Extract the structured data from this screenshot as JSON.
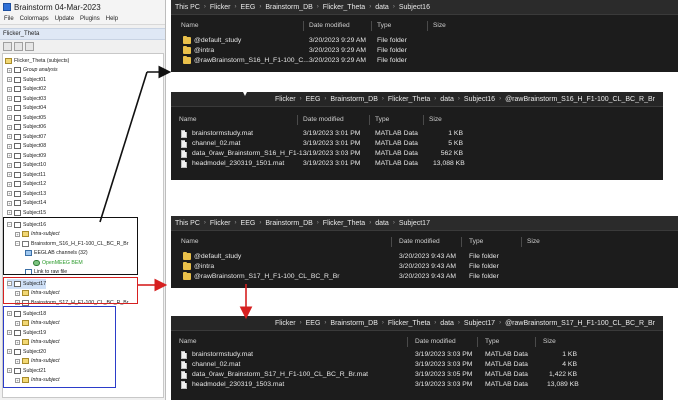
{
  "brainstorm": {
    "title": "Brainstorm 04-Mar-2023",
    "menu": [
      "File",
      "Colormaps",
      "Update",
      "Plugins",
      "Help"
    ],
    "protocol": "Flicker_Theta",
    "tree": {
      "root": "Flicker_Theta (subjects)",
      "group": "Group analysis",
      "subjects_a": [
        "Subject01",
        "Subject02",
        "Subject03",
        "Subject04",
        "Subject05",
        "Subject06",
        "Subject07",
        "Subject08",
        "Subject09",
        "Subject10",
        "Subject11",
        "Subject12",
        "Subject13",
        "Subject14",
        "Subject15"
      ],
      "subject16": "Subject16",
      "intra": "Intra-subject",
      "condition16": "Brainstorm_S16_H_F1-100_CL_BC_R_Br",
      "channels": "EEGLAB channels (32)",
      "bem": "OpenMEEG BEM",
      "link": "Link to raw file",
      "subject17": "Subject17",
      "condition17": "Brainstorm_S17_H_F1-100_CL_BC_R_Br",
      "subjects_b": [
        "Subject18",
        "Subject19",
        "Subject20",
        "Subject21"
      ]
    }
  },
  "explorer1": {
    "path": [
      "This PC",
      "Flicker",
      "EEG",
      "Brainstorm_DB",
      "Flicker_Theta",
      "data",
      "Subject16"
    ],
    "headers": [
      "Name",
      "Date modified",
      "Type",
      "Size"
    ],
    "rows": [
      {
        "name": "@default_study",
        "date": "3/20/2023 9:29 AM",
        "type": "File folder",
        "size": ""
      },
      {
        "name": "@intra",
        "date": "3/20/2023 9:29 AM",
        "type": "File folder",
        "size": ""
      },
      {
        "name": "@rawBrainstorm_S16_H_F1-100_C...",
        "date": "3/20/2023 9:29 AM",
        "type": "File folder",
        "size": ""
      }
    ]
  },
  "explorer2": {
    "path": [
      "Flicker",
      "EEG",
      "Brainstorm_DB",
      "Flicker_Theta",
      "data",
      "Subject16",
      "@rawBrainstorm_S16_H_F1-100_CL_BC_R_Br"
    ],
    "headers": [
      "Name",
      "Date modified",
      "Type",
      "Size"
    ],
    "rows": [
      {
        "name": "brainstormstudy.mat",
        "date": "3/19/2023 3:01 PM",
        "type": "MATLAB Data",
        "size": "1 KB"
      },
      {
        "name": "channel_02.mat",
        "date": "3/19/2023 3:01 PM",
        "type": "MATLAB Data",
        "size": "5 KB"
      },
      {
        "name": "data_0raw_Brainstorm_S16_H_F1-1...",
        "date": "3/19/2023 3:03 PM",
        "type": "MATLAB Data",
        "size": "562 KB"
      },
      {
        "name": "headmodel_230319_1501.mat",
        "date": "3/19/2023 3:01 PM",
        "type": "MATLAB Data",
        "size": "13,088 KB"
      }
    ]
  },
  "explorer3": {
    "path": [
      "This PC",
      "Flicker",
      "EEG",
      "Brainstorm_DB",
      "Flicker_Theta",
      "data",
      "Subject17"
    ],
    "headers": [
      "Name",
      "Date modified",
      "Type",
      "Size"
    ],
    "rows": [
      {
        "name": "@default_study",
        "date": "3/20/2023 9:43 AM",
        "type": "File folder",
        "size": ""
      },
      {
        "name": "@intra",
        "date": "3/20/2023 9:43 AM",
        "type": "File folder",
        "size": ""
      },
      {
        "name": "@rawBrainstorm_S17_H_F1-100_CL_BC_R_Br",
        "date": "3/20/2023 9:43 AM",
        "type": "File folder",
        "size": ""
      }
    ]
  },
  "explorer4": {
    "path": [
      "Flicker",
      "EEG",
      "Brainstorm_DB",
      "Flicker_Theta",
      "data",
      "Subject17",
      "@rawBrainstorm_S17_H_F1-100_CL_BC_R_Br"
    ],
    "headers": [
      "Name",
      "Date modified",
      "Type",
      "Size"
    ],
    "rows": [
      {
        "name": "brainstormstudy.mat",
        "date": "3/19/2023 3:03 PM",
        "type": "MATLAB Data",
        "size": "1 KB"
      },
      {
        "name": "channel_02.mat",
        "date": "3/19/2023 3:03 PM",
        "type": "MATLAB Data",
        "size": "4 KB"
      },
      {
        "name": "data_0raw_Brainstorm_S17_H_F1-100_CL_BC_R_Br.mat",
        "date": "3/19/2023 3:05 PM",
        "type": "MATLAB Data",
        "size": "1,422 KB"
      },
      {
        "name": "headmodel_230319_1503.mat",
        "date": "3/19/2023 3:03 PM",
        "type": "MATLAB Data",
        "size": "13,089 KB"
      }
    ]
  },
  "colors": {
    "box_black": "#111111",
    "box_red": "#d62020",
    "box_blue": "#2b3cc9",
    "explorer_bg": "#1c1c1c",
    "folder": "#e9c04a"
  }
}
